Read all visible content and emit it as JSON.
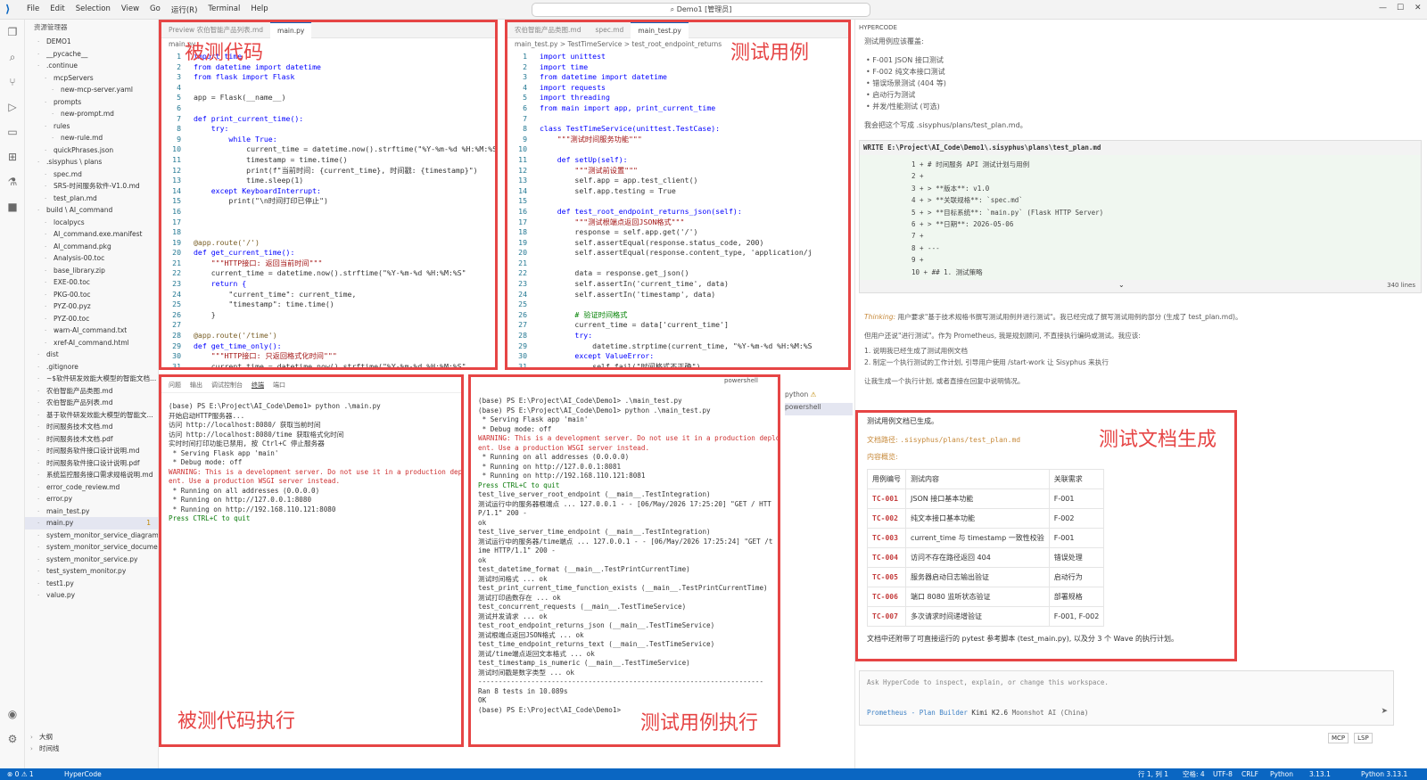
{
  "titlebar": {
    "menus": [
      "File",
      "Edit",
      "Selection",
      "View",
      "Go",
      "运行(R)",
      "Terminal",
      "Help"
    ],
    "search": "Demo1 [管理员]"
  },
  "explorer": {
    "title": "资源管理器",
    "items": [
      "DEMO1",
      "__pycache__",
      ".continue",
      "mcpServers",
      "new-mcp-server.yaml",
      "prompts",
      "new-prompt.md",
      "rules",
      "new-rule.md",
      "quickPhrases.json",
      ".sisyphus \\ plans",
      "spec.md",
      "SRS-时间服务软件-V1.0.md",
      "test_plan.md",
      "build \\ AI_command",
      "localpycs",
      "AI_command.exe.manifest",
      "AI_command.pkg",
      "Analysis-00.toc",
      "base_library.zip",
      "EXE-00.toc",
      "PKG-00.toc",
      "PYZ-00.pyz",
      "PYZ-00.toc",
      "warn-AI_command.txt",
      "xref-AI_command.html",
      "dist",
      ".gitignore",
      "~$软件研发效能大模型的智能文档...",
      "农伯智能产品类图.md",
      "农伯智能产品列表.md",
      "基于软件研发效能大模型的智能文...",
      "时间服务技术文档.md",
      "时间服务技术文档.pdf",
      "时间服务软件接口设计说明.md",
      "时间服务软件接口设计说明.pdf",
      "系统监控服务接口需求规格说明.md",
      "error_code_review.md",
      "error.py",
      "main_test.py",
      "main.py",
      "system_monitor_service_diagrams...",
      "system_monitor_service_document...",
      "system_monitor_service.py",
      "test_system_monitor.py",
      "test1.py",
      "value.py"
    ],
    "outline": "大纲",
    "timeline": "时间线",
    "main_badge": "1"
  },
  "editor1": {
    "tabs": [
      "Preview 农伯智能产品列表.md",
      "main.py"
    ],
    "tab_badge": "1",
    "crumb": "main.py",
    "label": "被测代码",
    "lines": [
      "import time",
      "from datetime import datetime",
      "from flask import Flask",
      "",
      "app = Flask(__name__)",
      "",
      "def print_current_time():",
      "    try:",
      "        while True:",
      "            current_time = datetime.now().strftime(\"%Y-%m-%d %H:%M:%S\")",
      "            timestamp = time.time()",
      "            print(f\"当前时间: {current_time}, 时间戳: {timestamp}\")",
      "            time.sleep(1)",
      "    except KeyboardInterrupt:",
      "        print(\"\\n时间打印已停止\")",
      "",
      "",
      "",
      "@app.route('/')",
      "def get_current_time():",
      "    \"\"\"HTTP接口: 返回当前时间\"\"\"",
      "    current_time = datetime.now().strftime(\"%Y-%m-%d %H:%M:%S\"",
      "    return {",
      "        \"current_time\": current_time,",
      "        \"timestamp\": time.time()",
      "    }",
      "",
      "@app.route('/time')",
      "def get_time_only():",
      "    \"\"\"HTTP接口: 只返回格式化时间\"\"\"",
      "    current_time = datetime.now().strftime(\"%Y-%m-%d %H:%M:%S\""
    ]
  },
  "editor2": {
    "tabs": [
      "农伯智能产品类图.md",
      "spec.md",
      "main_test.py"
    ],
    "crumb": "main_test.py > TestTimeService > test_root_endpoint_returns",
    "label": "测试用例",
    "lines": [
      "import unittest",
      "import time",
      "from datetime import datetime",
      "import requests",
      "import threading",
      "from main import app, print_current_time",
      "",
      "class TestTimeService(unittest.TestCase):",
      "    \"\"\"测试时间服务功能\"\"\"",
      "",
      "    def setUp(self):",
      "        \"\"\"测试前设置\"\"\"",
      "        self.app = app.test_client()",
      "        self.app.testing = True",
      "",
      "    def test_root_endpoint_returns_json(self):",
      "        \"\"\"测试根端点返回JSON格式\"\"\"",
      "        response = self.app.get('/')",
      "        self.assertEqual(response.status_code, 200)",
      "        self.assertEqual(response.content_type, 'application/j",
      "",
      "        data = response.get_json()",
      "        self.assertIn('current_time', data)",
      "        self.assertIn('timestamp', data)",
      "",
      "        # 验证时间格式",
      "        current_time = data['current_time']",
      "        try:",
      "            datetime.strptime(current_time, \"%Y-%m-%d %H:%M:%S",
      "        except ValueError:",
      "            self.fail(\"时间格式不正确\")"
    ]
  },
  "term1": {
    "tabs": [
      "问题",
      "输出",
      "调试控制台",
      "终端",
      "端口"
    ],
    "problems_badge": "1",
    "label": "被测代码执行",
    "lines": [
      "(base) PS E:\\Project\\AI_Code\\Demo1> python .\\main.py",
      "开始启动HTTP服务器...",
      "访问 http://localhost:8080/ 获取当前时间",
      "访问 http://localhost:8080/time 获取格式化时间",
      "实时时间打印功能已禁用, 按 Ctrl+C 停止服务器",
      " * Serving Flask app 'main'",
      " * Debug mode: off",
      "WARNING: This is a development server. Do not use it in a production deploym",
      "ent. Use a production WSGI server instead.",
      " * Running on all addresses (0.0.0.0)",
      " * Running on http://127.0.0.1:8080",
      " * Running on http://192.168.110.121:8080",
      "Press CTRL+C to quit"
    ]
  },
  "term2": {
    "label": "测试用例执行",
    "shell": "powershell",
    "side": [
      "python",
      "powershell"
    ],
    "lines": [
      "(base) PS E:\\Project\\AI_Code\\Demo1> .\\main_test.py",
      "(base) PS E:\\Project\\AI_Code\\Demo1> python .\\main_test.py",
      " * Serving Flask app 'main'",
      " * Debug mode: off",
      "WARNING: This is a development server. Do not use it in a production deploym",
      "ent. Use a production WSGI server instead.",
      " * Running on all addresses (0.0.0.0)",
      " * Running on http://127.0.0.1:8081",
      " * Running on http://192.168.110.121:8081",
      "Press CTRL+C to quit",
      "test_live_server_root_endpoint (__main__.TestIntegration)",
      "测试运行中的服务器根端点 ... 127.0.0.1 - - [06/May/2026 17:25:20] \"GET / HTT",
      "P/1.1\" 200 -",
      "ok",
      "test_live_server_time_endpoint (__main__.TestIntegration)",
      "测试运行中的服务器/time端点 ... 127.0.0.1 - - [06/May/2026 17:25:24] \"GET /t",
      "ime HTTP/1.1\" 200 -",
      "ok",
      "test_datetime_format (__main__.TestPrintCurrentTime)",
      "测试时间格式 ... ok",
      "test_print_current_time_function_exists (__main__.TestPrintCurrentTime)",
      "测试打印函数存在 ... ok",
      "test_concurrent_requests (__main__.TestTimeService)",
      "测试并发请求 ... ok",
      "test_root_endpoint_returns_json (__main__.TestTimeService)",
      "测试根端点返回JSON格式 ... ok",
      "test_time_endpoint_returns_text (__main__.TestTimeService)",
      "测试/time端点返回文本格式 ... ok",
      "test_timestamp_is_numeric (__main__.TestTimeService)",
      "测试时间戳是数字类型 ... ok",
      "",
      "----------------------------------------------------------------------",
      "Ran 8 tests in 10.089s",
      "",
      "OK",
      "(base) PS E:\\Project\\AI_Code\\Demo1> "
    ]
  },
  "right": {
    "title": "HYPERCODE",
    "intro": "测试用例应该覆盖:",
    "bullets": [
      "F-001 JSON 接口测试",
      "F-002 纯文本接口测试",
      "错误场景测试 (404 等)",
      "启动行为测试",
      "并发/性能测试 (可选)"
    ],
    "write_note": "我会把这个写成 .sisyphus/plans/test_plan.md。",
    "write_hdr": "WRITE E:\\Project\\AI_Code\\Demo1\\.sisyphus\\plans\\test_plan.md",
    "diff": [
      "1 + # 时间服务 API 测试计划与用例",
      "2 +",
      "3 + > **版本**: v1.0",
      "4 + > **关联规格**: `spec.md`",
      "5 + > **目标系统**: `main.py` (Flask HTTP Server)",
      "6 + > **日期**: 2026-05-06",
      "7 +",
      "8 + ---",
      "9 +",
      "10 + ## 1. 测试策略"
    ],
    "lines_count": "340 lines",
    "thinking_label": "Thinking:",
    "thinking": "用户要求\"基于技术规格书撰写测试用例并进行测试\"。我已经完成了撰写测试用例的部分 (生成了 test_plan.md)。",
    "p2": "但用户还说\"进行测试\"。作为 Prometheus, 我是规划顾问, 不直接执行编码或测试。我应该:",
    "steps": [
      "1. 说明我已经生成了测试用例文档",
      "2. 制定一个执行测试的工作计划, 引导用户使用 /start-work 让 Sisyphus 来执行"
    ],
    "p3": "让我生成一个执行计划, 或者直接在回复中说明情况。",
    "gen_title": "测试用例文档已生成。",
    "path_label": "文档路径:",
    "path": ".sisyphus/plans/test_plan.md",
    "overview": "内容概览:",
    "label": "测试文档生成",
    "table_head": [
      "用例编号",
      "测试内容",
      "关联需求"
    ],
    "table": [
      [
        "TC-001",
        "JSON 接口基本功能",
        "F-001"
      ],
      [
        "TC-002",
        "纯文本接口基本功能",
        "F-002"
      ],
      [
        "TC-003",
        "current_time 与 timestamp 一致性校验",
        "F-001"
      ],
      [
        "TC-004",
        "访问不存在路径返回 404",
        "错误处理"
      ],
      [
        "TC-005",
        "服务器启动日志输出验证",
        "启动行为"
      ],
      [
        "TC-006",
        "端口 8080 监听状态验证",
        "部署规格"
      ],
      [
        "TC-007",
        "多次请求时间递增验证",
        "F-001, F-002"
      ]
    ],
    "footer_note": "文档中还附带了可直接运行的 pytest 参考脚本 (test_main.py), 以及分 3 个 Wave 的执行计划。",
    "ask_placeholder": "Ask HyperCode to inspect, explain, or change this workspace.",
    "agent": "Prometheus - Plan Builder",
    "model": "Kimi K2.6",
    "provider": "Moonshot AI (China)",
    "mcp": "MCP",
    "lsp": "LSP"
  },
  "status": {
    "left": "⊗ 0 ⚠ 1",
    "app": "HyperCode",
    "pos": "行 1, 列 1",
    "spaces": "空格: 4",
    "enc": "UTF-8",
    "eol": "CRLF",
    "lang": "Python",
    "ver": "3.13.1",
    "pyver": "Python 3.13.1"
  }
}
